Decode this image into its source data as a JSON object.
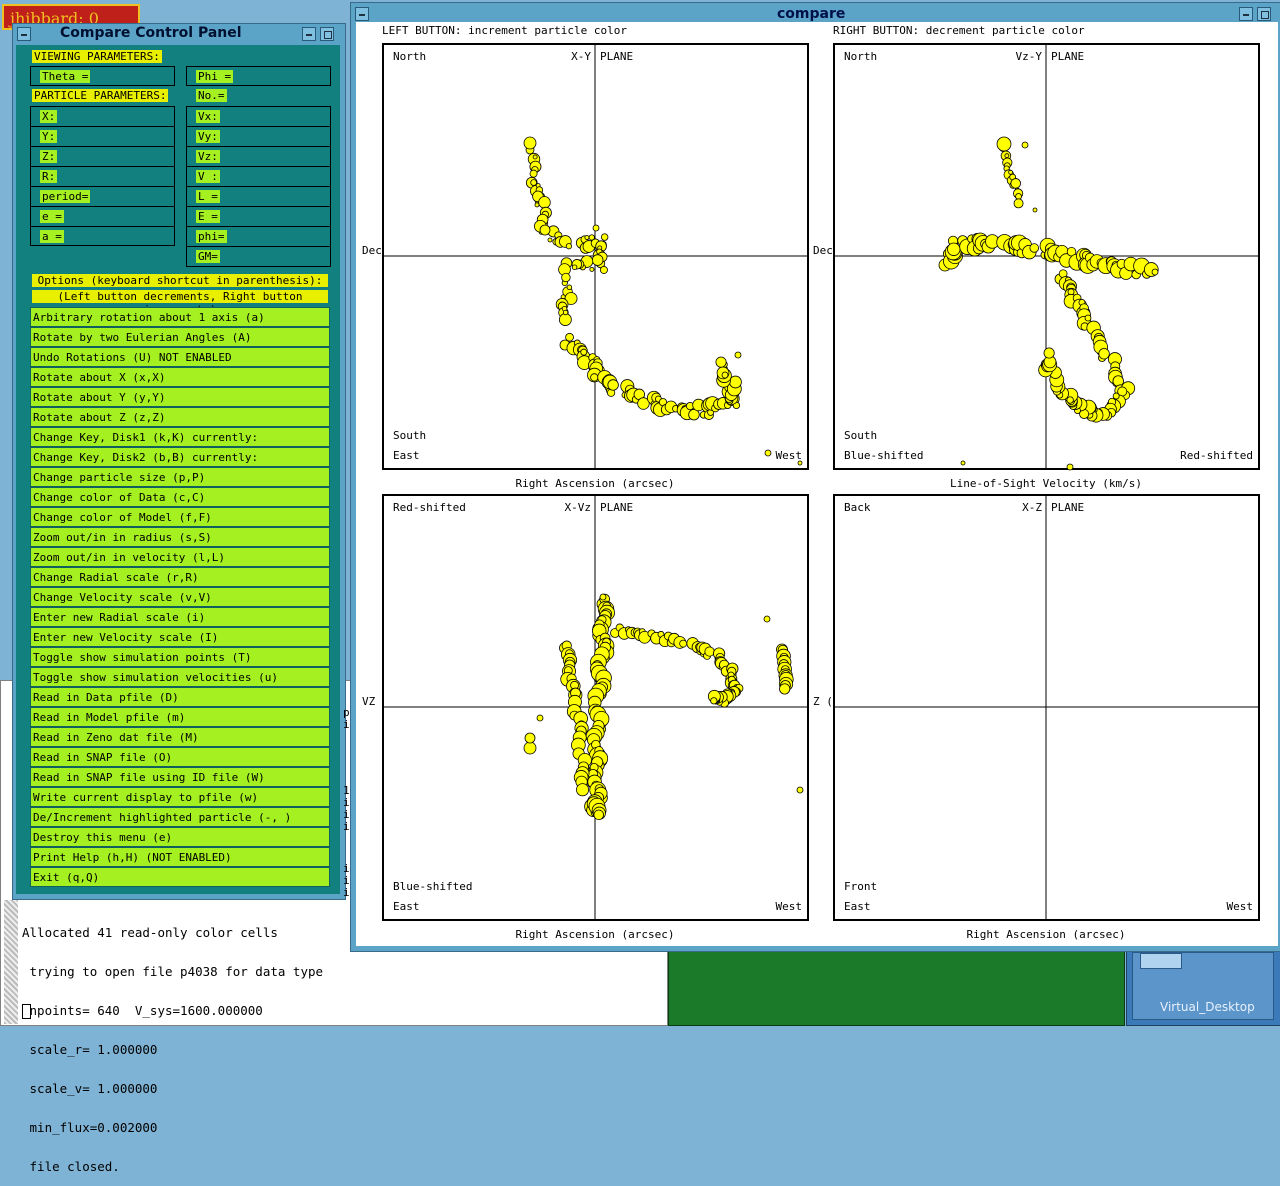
{
  "desktop": {
    "user_badge": "jhibbard: 0",
    "virtual_desktop_label": "Virtual_Desktop"
  },
  "terminal": {
    "lines": [
      "Allocated 41 read-only color cells",
      " trying to open file p4038 for data type",
      " npoints= 640  V_sys=1600.000000",
      " scale_r= 1.000000",
      " scale_v= 1.000000",
      " min_flux=0.002000",
      " file closed."
    ]
  },
  "control_panel": {
    "title": "Compare Control Panel",
    "viewing_header": "VIEWING PARAMETERS:",
    "theta_label": "Theta =",
    "phi_label": "Phi =",
    "particle_header": "PARTICLE PARAMETERS:",
    "no_label": "No.=",
    "left_params": [
      "X:",
      "Y:",
      "Z:",
      "R:",
      "period=",
      "e =",
      "a ="
    ],
    "right_params": [
      "Vx:",
      "Vy:",
      "Vz:",
      "V :",
      "L =",
      "E =",
      "phi=",
      "GM="
    ],
    "options_header": "Options (keyboard shortcut in parenthesis):",
    "options_subheader": "(Left button decrements, Right button increments)",
    "options": [
      "Arbitrary rotation about 1 axis (a)",
      "Rotate by two Eulerian Angles (A)",
      "Undo Rotations (U) NOT ENABLED",
      "Rotate about X   (x,X)",
      "Rotate about Y   (y,Y)",
      "Rotate about Z   (z,Z)",
      "Change Key, Disk1 (k,K)  currently:",
      "Change Key, Disk2 (b,B)  currently:",
      "Change particle size    (p,P)",
      "Change color of Data    (c,C)",
      "Change color of Model   (f,F)",
      "Zoom out/in in radius   (s,S)",
      "Zoom out/in in velocity (l,L)",
      "Change Radial scale (r,R)",
      "Change Velocity scale (v,V)",
      "Enter new Radial scale (i)",
      "Enter new Velocity scale (I)",
      "Toggle show simulation points       (T)",
      "Toggle show simulation velocities   (u)",
      "Read in Data pfile    (D)",
      "Read in Model pfile    (m)",
      "Read in Zeno dat file (M)",
      "Read in SNAP file (O)",
      "Read in SNAP file using ID file (W)",
      "Write current display to pfile (w)",
      "De/Increment highlighted particle (-, )",
      "Destroy this menu     (e)",
      "Print Help (h,H) (NOT ENABLED)",
      "Exit (q,Q)"
    ]
  },
  "compare": {
    "title": "compare",
    "left_button_hint": "LEFT BUTTON: increment particle color",
    "right_button_hint": "RIGHT BUTTON: decrement particle color",
    "point_color": "#ffff00",
    "panels": [
      {
        "tl": "North",
        "tc": "X-Y",
        "tr": "PLANE",
        "bl1": "South",
        "bl2": "East",
        "br": "West",
        "side": "Dec",
        "bottom": "Right Ascension (arcsec)"
      },
      {
        "tl": "North",
        "tc": "Vz-Y",
        "tr": "PLANE",
        "bl1": "South",
        "bl2": "Blue-shifted",
        "br": "Red-shifted",
        "side": "Dec",
        "bottom": "Line-of-Sight Velocity (km/s)"
      },
      {
        "tl": "Red-shifted",
        "tc": "X-Vz",
        "tr": "PLANE",
        "bl1": "Blue-shifted",
        "bl2": "East",
        "br": "West",
        "side": "VZ",
        "bottom": "Right Ascension (arcsec)"
      },
      {
        "tl": "Back",
        "tc": "X-Z",
        "tr": "PLANE",
        "bl1": "Front",
        "bl2": "East",
        "br": "West",
        "side": "Z (",
        "bottom": "Right Ascension (arcsec)"
      }
    ]
  }
}
